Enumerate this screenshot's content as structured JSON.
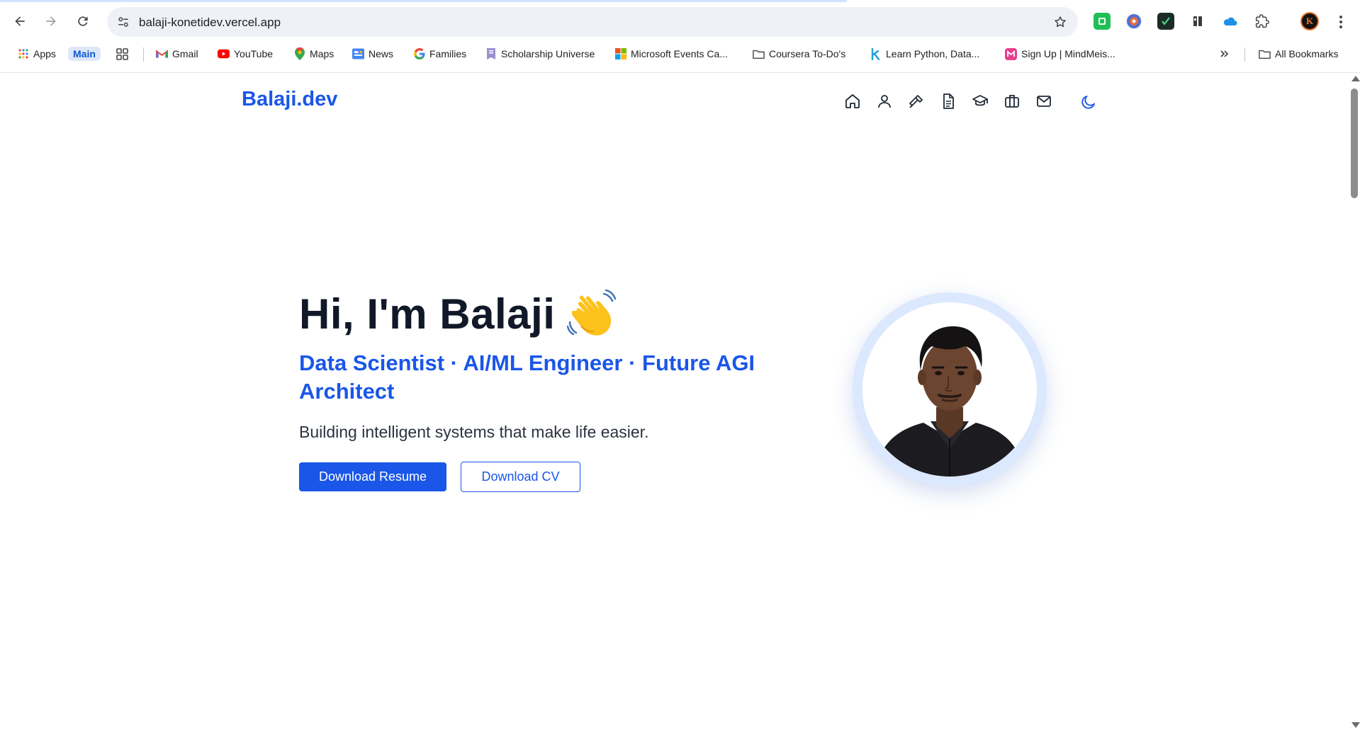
{
  "browser": {
    "url": "balaji-konetidev.vercel.app",
    "bookmarks": [
      {
        "label": "Apps",
        "icon": "apps-grid-icon"
      },
      {
        "label": "Main",
        "icon": ""
      },
      {
        "label": "",
        "icon": "tab-groups-icon"
      },
      {
        "label": "Gmail",
        "icon": "gmail-icon"
      },
      {
        "label": "YouTube",
        "icon": "youtube-icon"
      },
      {
        "label": "Maps",
        "icon": "maps-icon"
      },
      {
        "label": "News",
        "icon": "news-icon"
      },
      {
        "label": "Families",
        "icon": "google-icon"
      },
      {
        "label": "Scholarship Universe",
        "icon": "scholarship-icon"
      },
      {
        "label": "Microsoft Events Ca...",
        "icon": "microsoft-icon"
      },
      {
        "label": "Coursera To-Do's",
        "icon": "folder-icon"
      },
      {
        "label": "Learn Python, Data...",
        "icon": "k-icon"
      },
      {
        "label": "Sign Up | MindMeis...",
        "icon": "mindmeister-icon"
      }
    ],
    "all_bookmarks": "All Bookmarks",
    "profile_initial": "K"
  },
  "site": {
    "brand": "Balaji.dev",
    "nav_icons": [
      "home-icon",
      "user-icon",
      "hammer-icon",
      "document-icon",
      "graduation-cap-icon",
      "briefcase-icon",
      "mail-icon"
    ],
    "theme_icon": "moon-icon"
  },
  "hero": {
    "title": "Hi, I'm Balaji",
    "subtitle": "Data Scientist · AI/ML Engineer · Future AGI Architect",
    "tagline": "Building intelligent systems that make life easier.",
    "primary_button": "Download Resume",
    "secondary_button": "Download CV"
  },
  "colors": {
    "accent": "#1a56e8",
    "heading": "#111827",
    "ring": "#dbe8fe"
  }
}
